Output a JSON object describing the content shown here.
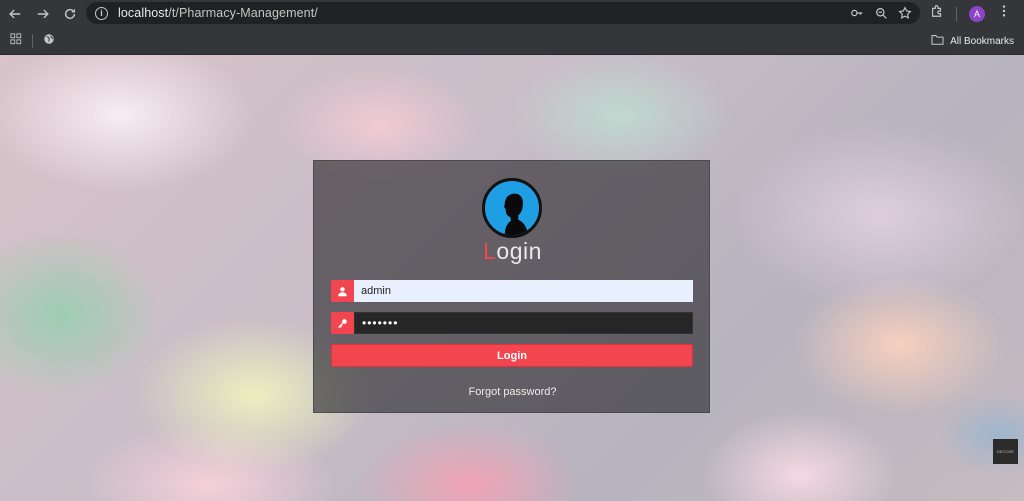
{
  "browser": {
    "url_host": "localhost",
    "url_path": "/t/Pharmacy-Management/",
    "profile_initial": "A",
    "bookmarks_label": "All Bookmarks"
  },
  "login": {
    "title_first_letter": "L",
    "title_rest": "ogin",
    "username_value": "admin",
    "password_value": "•••••••",
    "button_label": "Login",
    "forgot_link": "Forgot password?"
  },
  "colors": {
    "accent": "#f2454f",
    "logo_blue": "#1e9ee3",
    "chrome": "#35363a"
  },
  "icons": [
    "back-arrow-icon",
    "forward-arrow-icon",
    "reload-icon",
    "info-icon",
    "key-icon",
    "zoom-icon",
    "star-icon",
    "extensions-icon",
    "menu-icon",
    "apps-grid-icon",
    "globe-icon",
    "folder-icon",
    "user-icon",
    "key-field-icon"
  ]
}
